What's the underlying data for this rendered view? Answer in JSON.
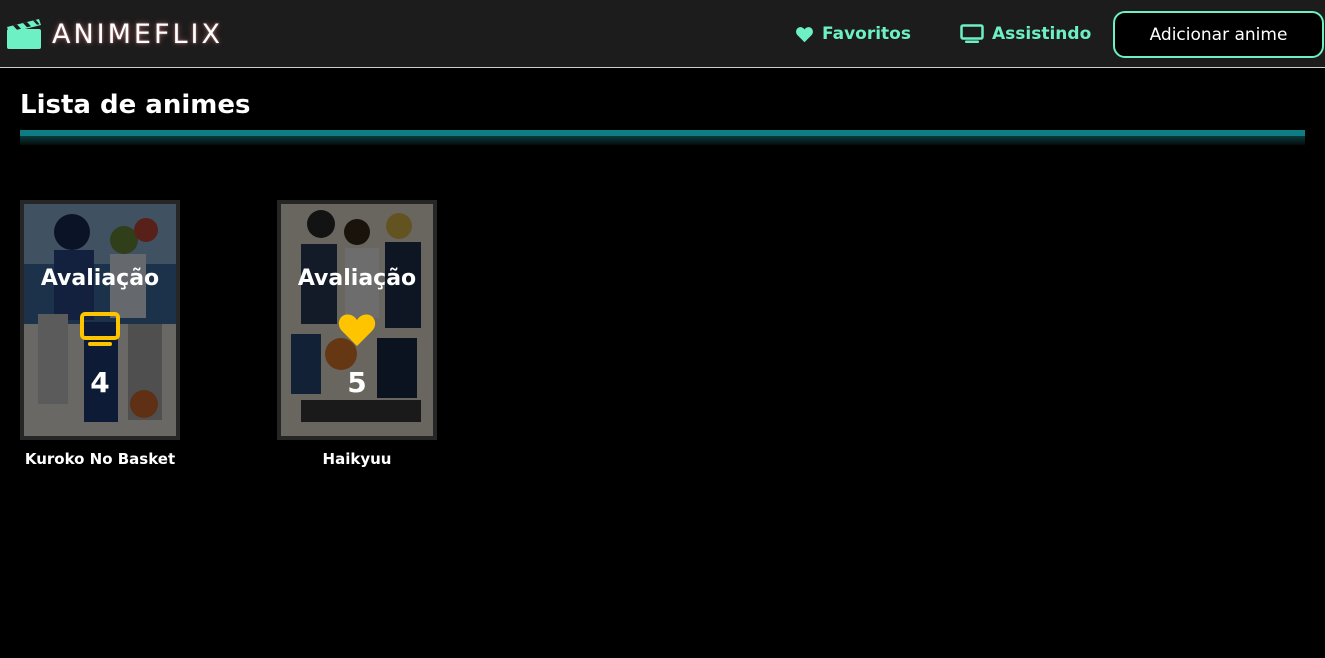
{
  "header": {
    "brand": "ANIMEFLIX",
    "brand_icon": "clapperboard-icon",
    "nav": [
      {
        "label": "Favoritos",
        "icon": "heart-icon"
      },
      {
        "label": "Assistindo",
        "icon": "tv-icon"
      }
    ],
    "add_button_label": "Adicionar anime"
  },
  "main": {
    "title": "Lista de animes",
    "cards": [
      {
        "title": "Kuroko No Basket",
        "rating_label": "Avaliação",
        "rating": "4",
        "status_icon": "tv-icon"
      },
      {
        "title": "Haikyuu",
        "rating_label": "Avaliação",
        "rating": "5",
        "status_icon": "heart-icon"
      }
    ]
  },
  "colors": {
    "header_bg": "#1c1c1c",
    "accent": "#6cf0c4",
    "title_bar": "#0e7c83",
    "rating_icon": "#ffc400",
    "page_bg": "#000000"
  }
}
